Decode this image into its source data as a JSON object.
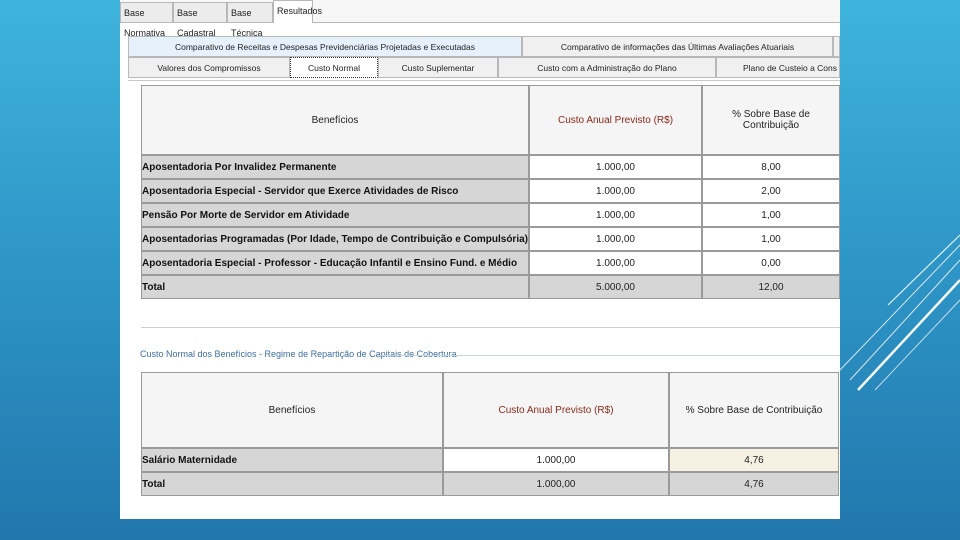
{
  "top_tabs": [
    {
      "label": "Base Normativa"
    },
    {
      "label": "Base Cadastral"
    },
    {
      "label": "Base Técnica"
    },
    {
      "label": "Resultados",
      "active": true
    }
  ],
  "sub_tabs_row1": [
    {
      "label": "Comparativo de Receitas e Despesas Previdenciárias Projetadas e Executadas",
      "selected": true
    },
    {
      "label": "Comparativo de informações das Últimas Avaliações Atuariais"
    }
  ],
  "sub_tabs_row2": [
    {
      "label": "Valores dos Compromissos"
    },
    {
      "label": "Custo Normal",
      "active": true
    },
    {
      "label": "Custo Suplementar"
    },
    {
      "label": "Custo com a Administração do Plano"
    },
    {
      "label": "Plano de Custeio a Cons"
    }
  ],
  "table1": {
    "headers": [
      "Benefícios",
      "Custo Anual Previsto (R$)",
      "% Sobre Base de Contribuição"
    ],
    "rows": [
      {
        "label": "Aposentadoria Por Invalidez Permanente",
        "custo": "1.000,00",
        "pct": "8,00"
      },
      {
        "label": "Aposentadoria Especial - Servidor que Exerce Atividades de Risco",
        "custo": "1.000,00",
        "pct": "2,00"
      },
      {
        "label": "Pensão Por Morte de Servidor em Atividade",
        "custo": "1.000,00",
        "pct": "1,00"
      },
      {
        "label": "Aposentadorias Programadas (Por Idade, Tempo de Contribuição e Compulsória)",
        "custo": "1.000,00",
        "pct": "1,00"
      },
      {
        "label": "Aposentadoria Especial - Professor - Educação Infantil e Ensino Fund. e Médio",
        "custo": "1.000,00",
        "pct": "0,00"
      }
    ],
    "total": {
      "label": "Total",
      "custo": "5.000,00",
      "pct": "12,00"
    }
  },
  "section2_title": "Custo Normal dos Benefícios - Regime de Repartição de Capitais de Cobertura",
  "table2": {
    "headers": [
      "Benefícios",
      "Custo Anual Previsto (R$)",
      "% Sobre Base de Contribuição"
    ],
    "rows": [
      {
        "label": "Salário Maternidade",
        "custo": "1.000,00",
        "pct": "4,76"
      }
    ],
    "total": {
      "label": "Total",
      "custo": "1.000,00",
      "pct": "4,76"
    }
  },
  "colors": {
    "accent_header": "#8b2a1a",
    "section_title": "#3b6fa3"
  }
}
